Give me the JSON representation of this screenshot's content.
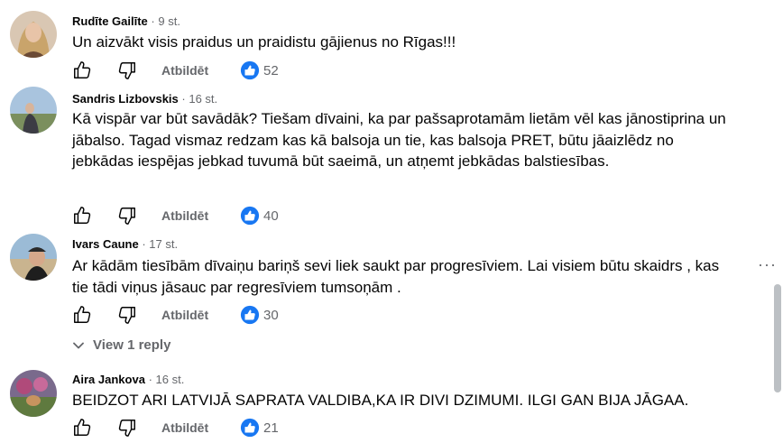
{
  "comments": [
    {
      "author": "Rudīte Gailīte",
      "age": "9 st.",
      "text": "Un aizvākt visis praidus un praidistu gājienus no Rīgas!!!",
      "reply_label": "Atbildēt",
      "like_count": "52"
    },
    {
      "author": "Sandris Lizbovskis",
      "age": "16 st.",
      "text": "Kā vispār var būt savādāk? Tiešam dīvaini, ka par pašsaprotamām lietām vēl kas jānostiprina un jābalso. Tagad vismaz redzam kas kā balsoja un tie, kas balsoja PRET, būtu jāaizlēdz no jebkādas iespējas jebkad tuvumā būt saeimā, un atņemt jebkādas balstiesības.",
      "reply_label": "Atbildēt",
      "like_count": "40"
    },
    {
      "author": "Ivars Caune",
      "age": "17 st.",
      "text": "Ar kādām tiesībām dīvaiņu bariņš sevi liek saukt par progresīviem. Lai visiem būtu skaidrs , kas tie tādi viņus jāsauc par regresīviem tumsoņām .",
      "reply_label": "Atbildēt",
      "like_count": "30"
    },
    {
      "author": "Aira Jankova",
      "age": "16 st.",
      "text": "BEIDZOT ARI LATVIJĀ SAPRATA VALDIBA,KA IR DIVI DZIMUMI. ILGI GAN BIJA JĀGAA.",
      "reply_label": "Atbildēt",
      "like_count": "21"
    }
  ],
  "view_replies_label": "View 1 reply",
  "more_label": "···",
  "meta_separator": "·",
  "icons": {
    "like": "thumbs-up-outline-icon",
    "dislike": "thumbs-down-outline-icon",
    "reaction": "blue-like-reaction-icon",
    "expand": "chevron-down-icon",
    "more": "more-horizontal-icon"
  },
  "colors": {
    "text": "#050505",
    "secondary": "#65676b",
    "like_blue": "#1877f2",
    "scroll_thumb": "#bcc0c4"
  }
}
